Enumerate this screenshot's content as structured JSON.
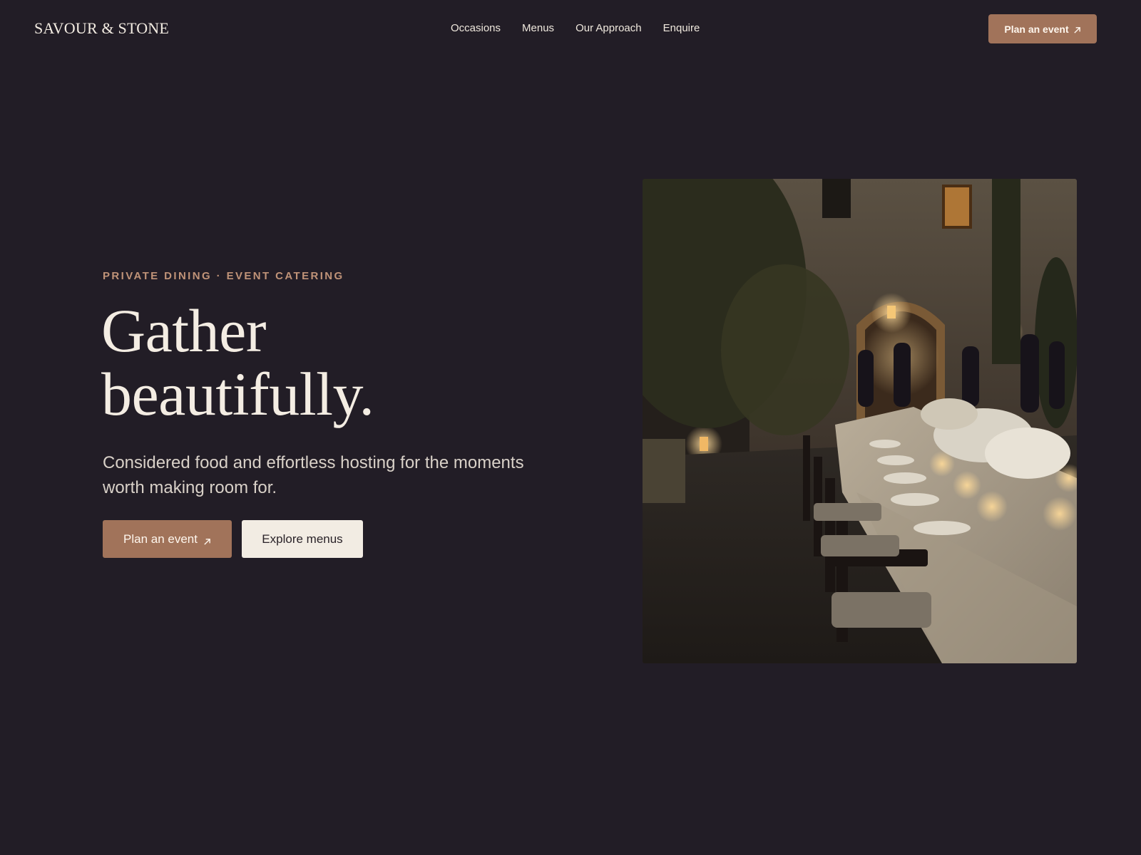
{
  "header": {
    "logo": "SAVOUR & STONE",
    "nav": [
      "Occasions",
      "Menus",
      "Our Approach",
      "Enquire"
    ],
    "cta_label": "Plan an event"
  },
  "hero": {
    "eyebrow": "PRIVATE DINING · EVENT CATERING",
    "headline_line1": "Gather",
    "headline_line2": "beautifully.",
    "lead": "Considered food and effortless hosting for the moments worth making room for.",
    "primary_button": "Plan an event",
    "secondary_button": "Explore menus"
  },
  "image": {
    "subject": "long candlelit banquet table in a stone courtyard at dusk"
  },
  "colors": {
    "background": "#221d26",
    "accent": "#a1735a",
    "eyebrow": "#c09378",
    "text": "#f4ede3",
    "secondary_button": "#f2ece3"
  },
  "icons": {
    "arrow": "arrow-up-right-icon"
  }
}
